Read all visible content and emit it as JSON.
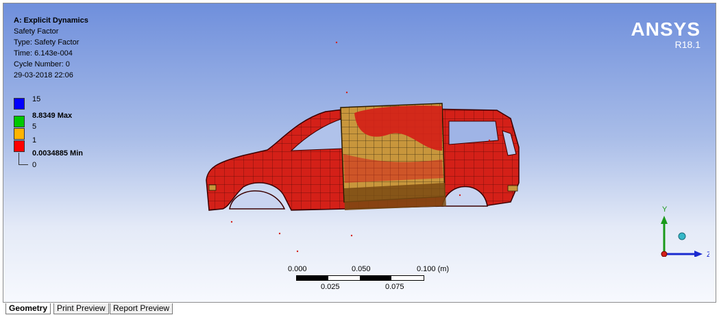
{
  "result_info": {
    "system": "A: Explicit Dynamics",
    "name": "Safety Factor",
    "type": "Type: Safety Factor",
    "time": "Time: 6.143e-004",
    "cycle": "Cycle Number: 0",
    "datetime": "29-03-2018 22:06"
  },
  "logo": {
    "brand": "ANSYS",
    "release": "R18.1"
  },
  "legend": {
    "bands": [
      {
        "color": "#0000ff"
      },
      {
        "color": "#00c800"
      },
      {
        "color": "#ffb400"
      },
      {
        "color": "#ff0000"
      }
    ],
    "labels": {
      "top": "15",
      "max": "8.8349 Max",
      "mid1": "5",
      "mid2": "1",
      "min": "0.0034885 Min",
      "zero": "0"
    }
  },
  "scale_bar": {
    "top_labels": [
      "0.000",
      "0.050",
      "0.100 (m)"
    ],
    "bottom_labels": [
      "0.025",
      "0.075"
    ]
  },
  "triad": {
    "x": "",
    "y": "Y",
    "z": "Z"
  },
  "tabs": [
    {
      "label": "Geometry",
      "active": true
    },
    {
      "label": "Print Preview",
      "active": false
    },
    {
      "label": "Report Preview",
      "active": false
    }
  ],
  "colors": {
    "model_red": "#d42018",
    "model_tan": "#c8963c",
    "axis_y": "#1a9a1a",
    "axis_z": "#1a2ad0"
  }
}
